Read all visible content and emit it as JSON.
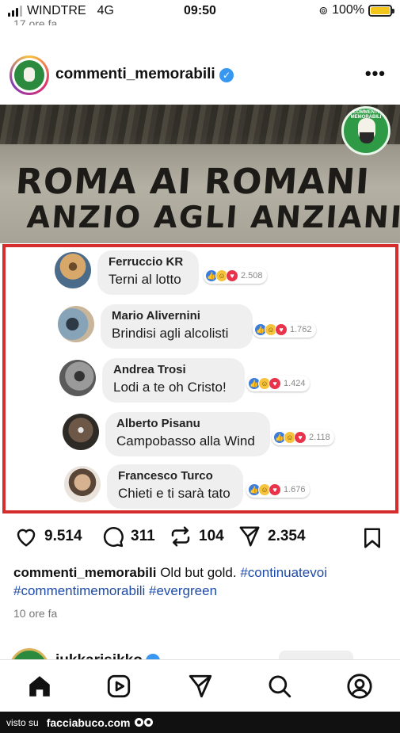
{
  "status_bar": {
    "carrier": "WINDTRE",
    "network": "4G",
    "time": "09:50",
    "battery": "100%",
    "battery_level": 1.0,
    "battery_color": "#f4c51a"
  },
  "previous_post": {
    "time": "17 ore fa"
  },
  "post": {
    "username": "commenti_memorabili",
    "verified": true,
    "more_icon": "ellipsis-icon",
    "image": {
      "graffiti_line1": "ROMA AI ROMANI",
      "graffiti_line2": "ANZIO AGLI ANZIANI!",
      "watermark": "COMMENTI MEMORABILI",
      "comments": [
        {
          "name": "Ferruccio KR",
          "text": "Terni al lotto",
          "count": "2.508"
        },
        {
          "name": "Mario Alivernini",
          "text": "Brindisi agli alcolisti",
          "count": "1.762"
        },
        {
          "name": "Andrea Trosi",
          "text": "Lodi a te oh Cristo!",
          "count": "1.424"
        },
        {
          "name": "Alberto Pisanu",
          "text": "Campobasso alla Wind",
          "count": "2.118"
        },
        {
          "name": "Francesco Turco",
          "text": "Chieti e ti sarà tato",
          "count": "1.676"
        }
      ],
      "frame_color": "#d52d2d"
    },
    "actions": {
      "likes": "9.514",
      "comments": "311",
      "reposts": "104",
      "shares": "2.354"
    },
    "caption": {
      "username": "commenti_memorabili",
      "text": "Old but gold.",
      "tag1": "#continuatevoi",
      "tag2": "#commentimemorabili",
      "tag3": "#evergreen"
    },
    "time": "10 ore fa"
  },
  "next_post": {
    "username": "jukkarisikko"
  },
  "tabbar": [
    "home-icon",
    "reels-icon",
    "send-icon",
    "search-icon",
    "profile-icon"
  ],
  "footer": {
    "prefix": "visto su",
    "site": "facciabuco.com"
  },
  "colors": {
    "link": "#1f4ba8",
    "verified": "#3897f0"
  }
}
